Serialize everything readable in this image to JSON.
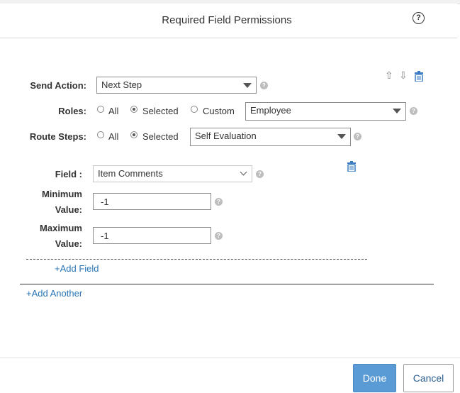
{
  "dialog": {
    "title": "Required Field Permissions",
    "help_glyph": "?"
  },
  "send_action": {
    "label": "Send Action:",
    "value": "Next Step"
  },
  "roles": {
    "label": "Roles:",
    "options": [
      "All",
      "Selected",
      "Custom"
    ],
    "selected": "Selected",
    "value": "Employee"
  },
  "route_steps": {
    "label": "Route Steps:",
    "options": [
      "All",
      "Selected"
    ],
    "selected": "Selected",
    "value": "Self Evaluation"
  },
  "field": {
    "label": "Field :",
    "value": "Item Comments",
    "minimum": {
      "label_line1": "Minimum",
      "label_line2": "Value:",
      "value": "-1"
    },
    "maximum": {
      "label_line1": "Maximum",
      "label_line2": "Value:",
      "value": "-1"
    }
  },
  "links": {
    "add_field": "+Add Field",
    "add_another": "+Add Another"
  },
  "footer": {
    "done": "Done",
    "cancel": "Cancel"
  },
  "icons": [
    "help-icon",
    "move-up-icon",
    "move-down-icon",
    "trash-icon"
  ],
  "colors": {
    "primary": "#5b9bd5",
    "link": "#2a75b6",
    "trash": "#3a7cc4"
  }
}
